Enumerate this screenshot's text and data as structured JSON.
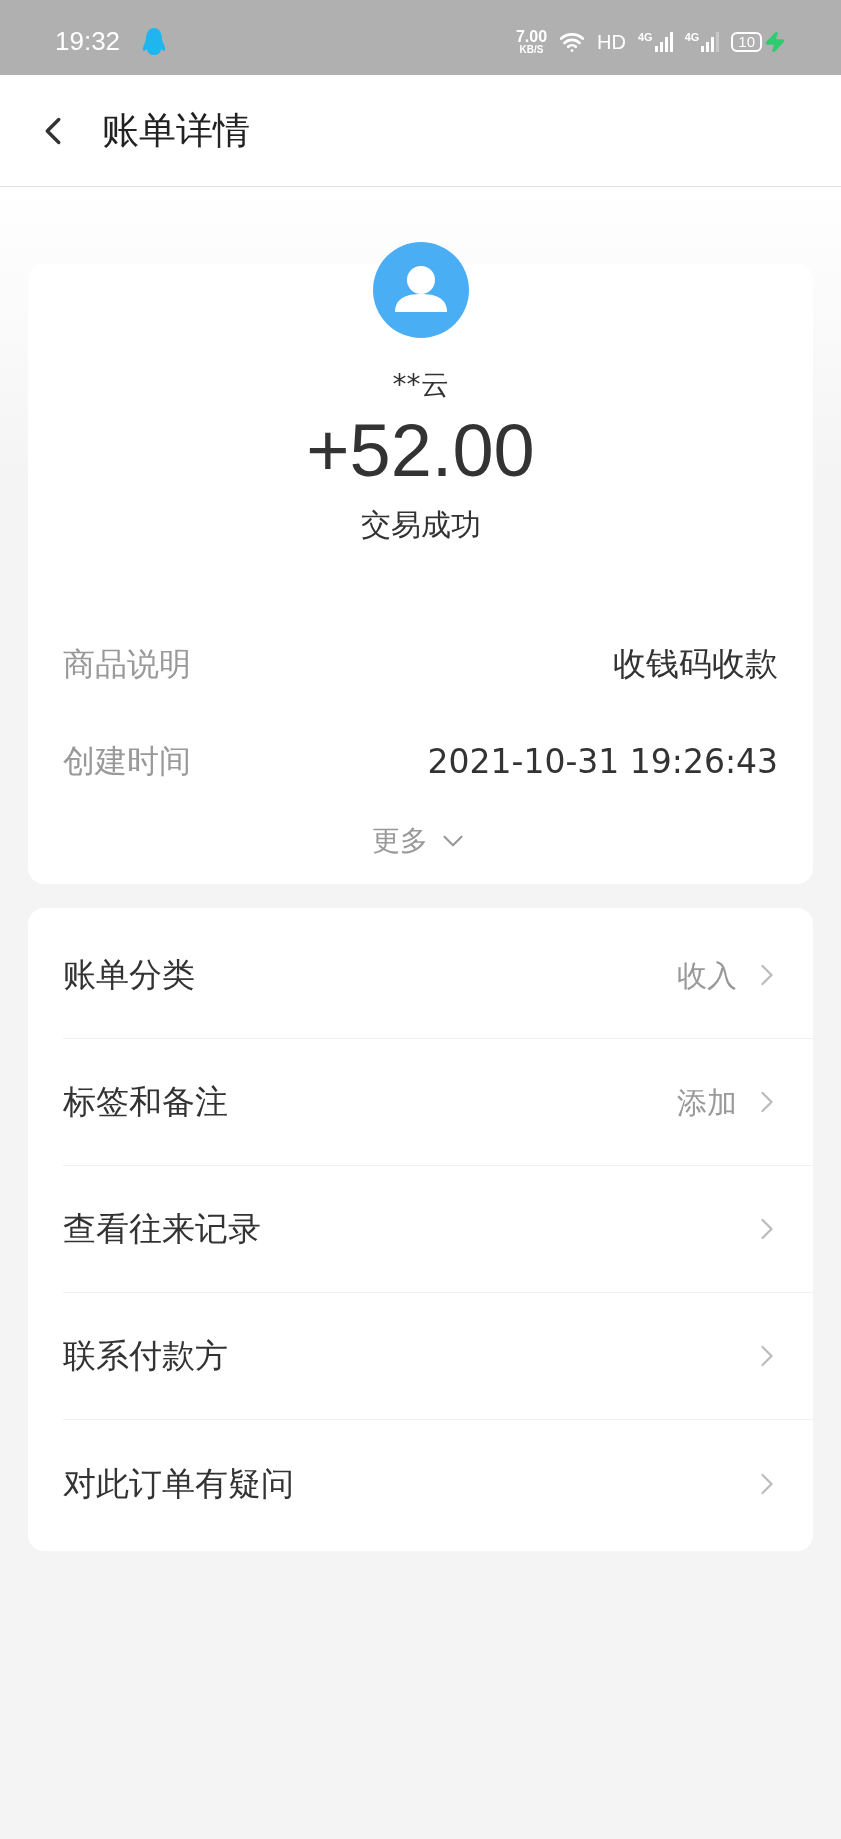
{
  "status_bar": {
    "time": "19:32",
    "speed_value": "7.00",
    "speed_unit": "KB/S",
    "hd": "HD",
    "networks": [
      "4G",
      "4G"
    ],
    "battery": "10"
  },
  "header": {
    "title": "账单详情"
  },
  "summary": {
    "payer": "**云",
    "amount": "+52.00",
    "status": "交易成功",
    "details": [
      {
        "label": "商品说明",
        "value": "收钱码收款"
      },
      {
        "label": "创建时间",
        "value": "2021-10-31 19:26:43"
      }
    ],
    "more": "更多"
  },
  "menu": [
    {
      "label": "账单分类",
      "value": "收入"
    },
    {
      "label": "标签和备注",
      "value": "添加"
    },
    {
      "label": "查看往来记录"
    },
    {
      "label": "联系付款方"
    },
    {
      "label": "对此订单有疑问"
    }
  ]
}
